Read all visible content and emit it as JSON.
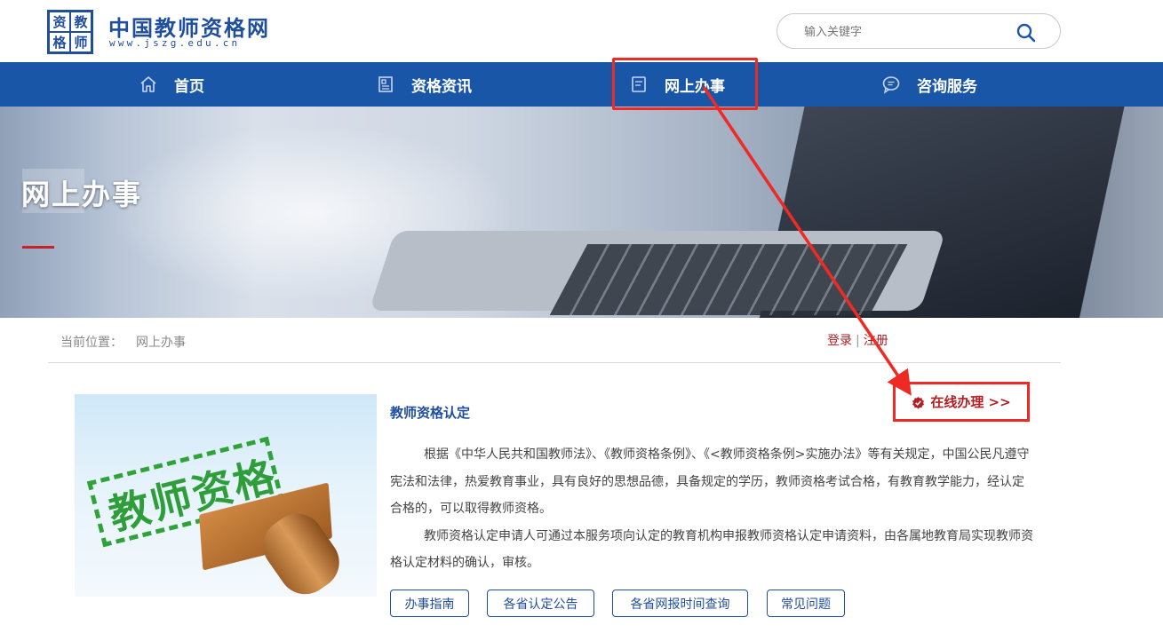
{
  "header": {
    "logo_chars": [
      "资",
      "教",
      "格",
      "师"
    ],
    "site_name": "中国教师资格网",
    "site_url": "www.jszg.edu.cn",
    "search_placeholder": "输入关键字",
    "search_icon": "search-icon"
  },
  "nav": {
    "items": [
      {
        "label": "首页",
        "icon": "home-icon"
      },
      {
        "label": "资格资讯",
        "icon": "news-icon"
      },
      {
        "label": "网上办事",
        "icon": "document-icon"
      },
      {
        "label": "咨询服务",
        "icon": "chat-icon"
      }
    ]
  },
  "banner": {
    "title": "网上办事"
  },
  "breadcrumb": {
    "label": "当前位置：",
    "current": "网上办事"
  },
  "auth": {
    "login": "登录",
    "separator": "|",
    "register": "注册"
  },
  "card": {
    "title": "教师资格认定",
    "online_button": "在线办理 >>",
    "paragraphs": [
      "根据《中华人民共和国教师法》、《教师资格条例》、《<教师资格条例>实施办法》等有关规定，中国公民凡遵守宪法和法律，热爱教育事业，具有良好的思想品德，具备规定的学历，教师资格考试合格，有教育教学能力，经认定合格的，可以取得教师资格。",
      "教师资格认定申请人可通过本服务项向认定的教育机构申报教师资格认定申请资料，由各属地教育局实现教师资格认定材料的确认，审核。"
    ],
    "image_text": "教师资格",
    "links": [
      "办事指南",
      "各省认定公告",
      "各省网报时间查询",
      "常见问题"
    ]
  },
  "colors": {
    "brand_blue": "#1a56a8",
    "accent_red": "#b21e23",
    "annotation_red": "#ee2a24"
  }
}
